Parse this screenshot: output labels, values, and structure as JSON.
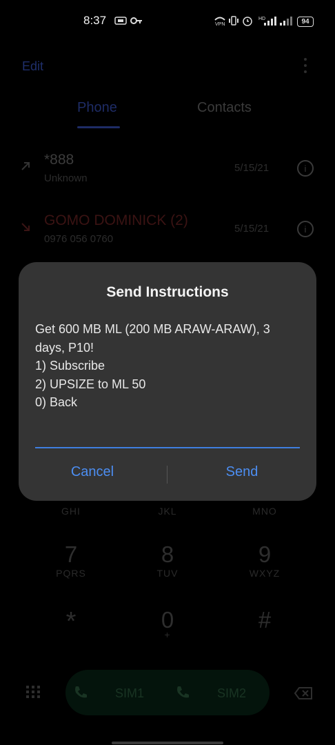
{
  "status_bar": {
    "time": "8:37",
    "battery": "94"
  },
  "app": {
    "edit_label": "Edit",
    "tabs": [
      {
        "label": "Phone",
        "active": true
      },
      {
        "label": "Contacts",
        "active": false
      }
    ],
    "calls": [
      {
        "name": "*888",
        "sub": "Unknown",
        "date": "5/15/21"
      },
      {
        "name": "GOMO DOMINICK (2)",
        "sub": "0976 056 0760",
        "date": "5/15/21"
      }
    ],
    "keypad": [
      {
        "digit": "",
        "letters": "GHI"
      },
      {
        "digit": "",
        "letters": "JKL"
      },
      {
        "digit": "",
        "letters": "MNO"
      },
      {
        "digit": "7",
        "letters": "PQRS"
      },
      {
        "digit": "8",
        "letters": "TUV"
      },
      {
        "digit": "9",
        "letters": "WXYZ"
      },
      {
        "digit": "*",
        "letters": ""
      },
      {
        "digit": "0",
        "letters": "+"
      },
      {
        "digit": "#",
        "letters": ""
      }
    ],
    "sim1_label": "SIM1",
    "sim2_label": "SIM2"
  },
  "dialog": {
    "title": "Send Instructions",
    "message": "Get 600 MB ML (200 MB ARAW-ARAW), 3 days, P10!\n1) Subscribe\n2) UPSIZE to ML 50\n0) Back",
    "input_value": "",
    "cancel_label": "Cancel",
    "send_label": "Send",
    "accent_color": "#4c8ef2"
  }
}
